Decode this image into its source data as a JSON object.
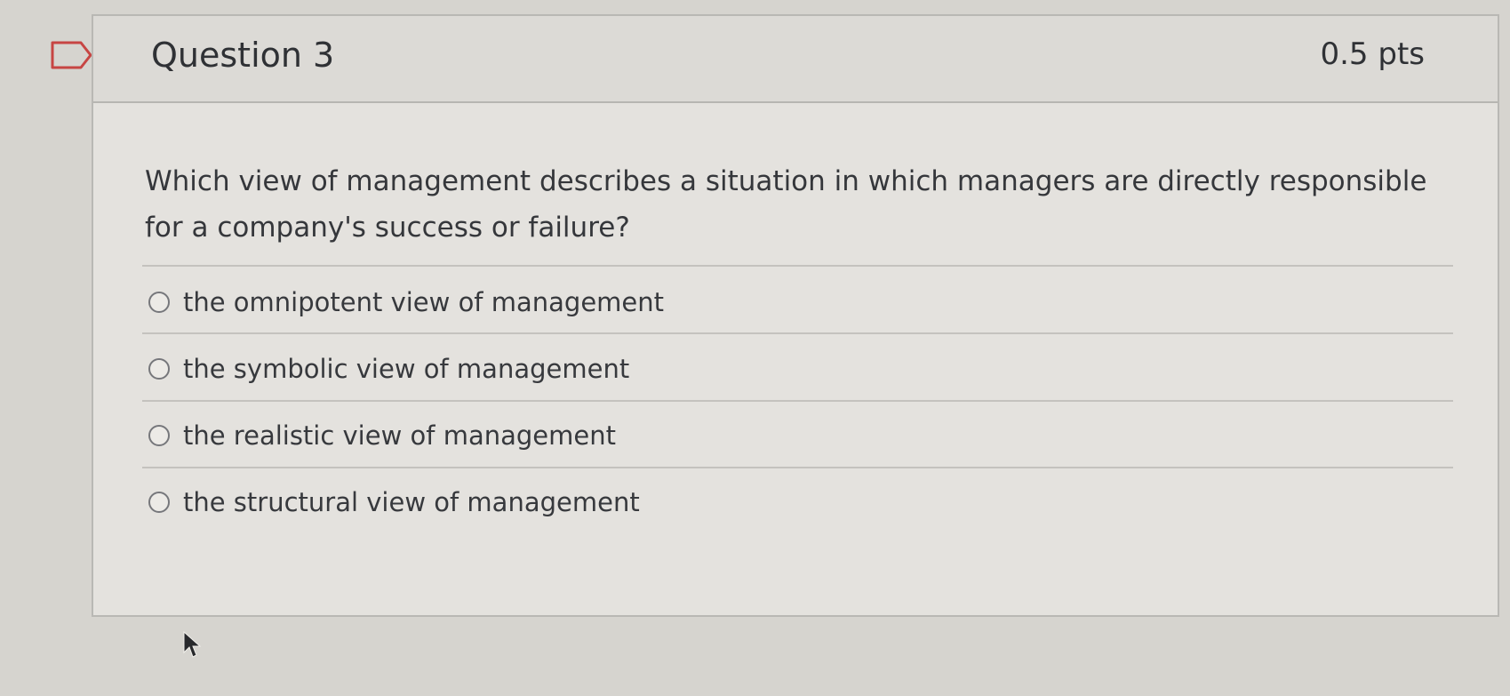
{
  "question": {
    "title": "Question 3",
    "points": "0.5 pts",
    "text": "Which view of management describes a situation in which managers are directly responsible for a company's success or failure?",
    "answers": [
      {
        "label": "the omnipotent view of management"
      },
      {
        "label": "the symbolic view of management"
      },
      {
        "label": "the realistic view of management"
      },
      {
        "label": "the structural view of management"
      }
    ]
  },
  "icons": {
    "flag": "flag-icon",
    "cursor": "mouse-pointer-icon",
    "radio": "radio-button-unselected"
  },
  "colors": {
    "page_background": "#d6d4cf",
    "card_background": "#e4e2de",
    "header_background": "#dcdad6",
    "text": "#35373b"
  }
}
